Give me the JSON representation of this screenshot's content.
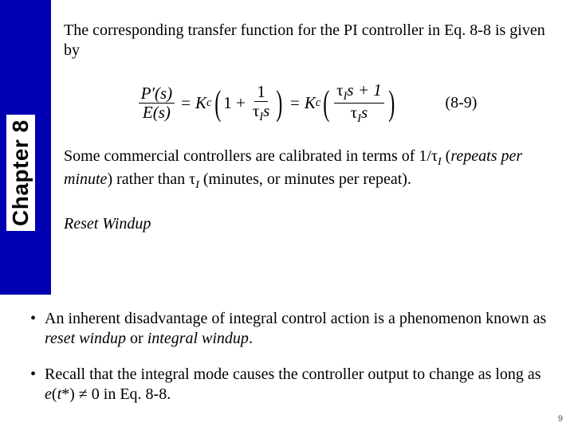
{
  "sidebar": {
    "chapter_label": "Chapter 8"
  },
  "intro": {
    "text_before": "The corresponding transfer function for the PI controller in Eq. 8-8 is given by"
  },
  "equation": {
    "lhs_num": "P′(s)",
    "lhs_den": "E(s)",
    "eq1": "=",
    "Kc1": "K",
    "Kc1_sub": "c",
    "open1": "(",
    "one": "1 +",
    "frac1_num": "1",
    "frac1_den_tau": "τ",
    "frac1_den_sub": "I",
    "frac1_den_s": "s",
    "close1": ")",
    "eq2": "=",
    "Kc2": "K",
    "Kc2_sub": "c",
    "open2": "(",
    "frac2_num_tau": "τ",
    "frac2_num_sub": "I",
    "frac2_num_tail": "s + 1",
    "frac2_den_tau": "τ",
    "frac2_den_sub": "I",
    "frac2_den_s": "s",
    "close2": ")",
    "number": "(8-9)"
  },
  "calibrated": {
    "part1": "Some commercial controllers are calibrated in terms of ",
    "inv_one": "1/",
    "tau": "τ",
    "tau_sub": "I",
    "part2": " (",
    "repeats": "repeats per minute",
    "part3": ") rather than ",
    "tau2": "τ",
    "tau2_sub": "I",
    "part4": " (minutes, or minutes per repeat)."
  },
  "section": {
    "title": "Reset Windup"
  },
  "bullets": [
    {
      "pre": "An inherent disadvantage of integral control action is a phenomenon known as ",
      "em1": "reset windup",
      "mid": " or ",
      "em2": "integral windup",
      "post": "."
    },
    {
      "pre": "Recall that the integral mode causes the controller output to change as long as ",
      "evar": "e",
      "paren_open": "(",
      "tvar": "t",
      "star": "*",
      "paren_close": ")",
      "neq": " ≠ 0 in Eq. 8-8."
    }
  ],
  "page_number": "9"
}
